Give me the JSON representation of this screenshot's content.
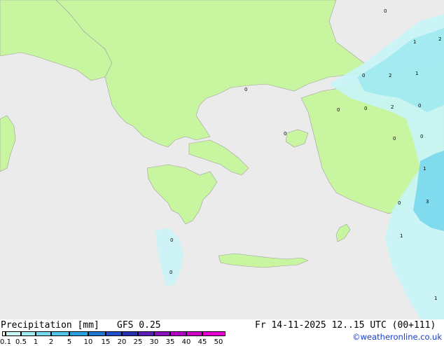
{
  "map": {
    "precip_labels": [
      "0",
      "1",
      "2",
      "2",
      "1",
      "0",
      "0",
      "0",
      "2",
      "0",
      "0",
      "0",
      "1",
      "0",
      "3",
      "1",
      "0",
      "0",
      "1",
      "0",
      "0"
    ]
  },
  "footer": {
    "title": "Precipitation [mm]",
    "model": "GFS 0.25",
    "valid_time": "Fr 14-11-2025 12..15 UTC (00+111)",
    "credit": "©weatheronline.co.uk",
    "scale_ticks": [
      "0.1",
      "0.5",
      "1",
      "2",
      "5",
      "10",
      "15",
      "20",
      "25",
      "30",
      "35",
      "40",
      "45",
      "50"
    ],
    "scale_colors": [
      "#fffff0",
      "#c8f5f8",
      "#a0eaf0",
      "#78d8ec",
      "#50c4ea",
      "#2aa0e0",
      "#1e78d2",
      "#2050c8",
      "#2830b4",
      "#5a20b4",
      "#8a10c0",
      "#b400c8",
      "#d200c8",
      "#e600d2"
    ]
  }
}
